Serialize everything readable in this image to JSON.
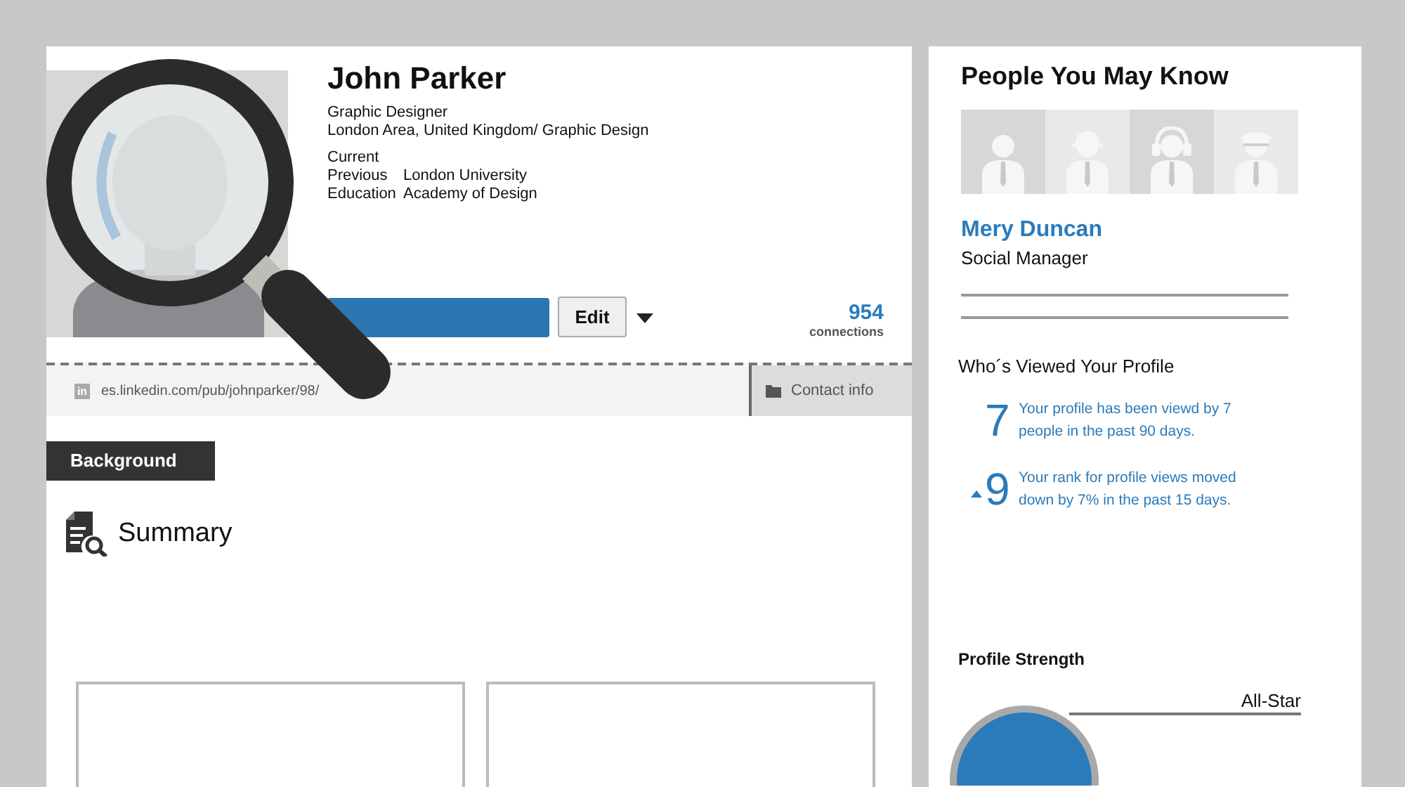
{
  "profile": {
    "name": "John Parker",
    "headline": "Graphic Designer",
    "location": "London Area, United Kingdom/ Graphic Design",
    "details": [
      {
        "label": "Current"
      },
      {
        "label": "Previous",
        "value": "London University"
      },
      {
        "label": "Education",
        "value": "Academy of Design"
      }
    ],
    "edit_button": "Edit",
    "connections": {
      "count": "954",
      "label": "connections"
    },
    "public_url": {
      "badge": "in",
      "url": "es.linkedin.com/pub/johnparker/98/"
    },
    "contact_info": "Contact info"
  },
  "section_tab": "Background",
  "summary": {
    "title": "Summary"
  },
  "people_you_may_know": {
    "title": "People You May Know",
    "person": {
      "name": "Mery Duncan",
      "role": "Social Manager"
    }
  },
  "profile_views": {
    "title": "Who´s Viewed Your Profile",
    "stats": [
      {
        "number": "7",
        "text": "Your profile has been viewd by 7 people in the past 90 days.",
        "trend_arrow": false
      },
      {
        "number": "9",
        "text": "Your rank for profile views moved down by 7% in the past 15 days.",
        "trend_arrow": true
      }
    ]
  },
  "profile_strength": {
    "title": "Profile Strength",
    "rating": "All-Star"
  }
}
